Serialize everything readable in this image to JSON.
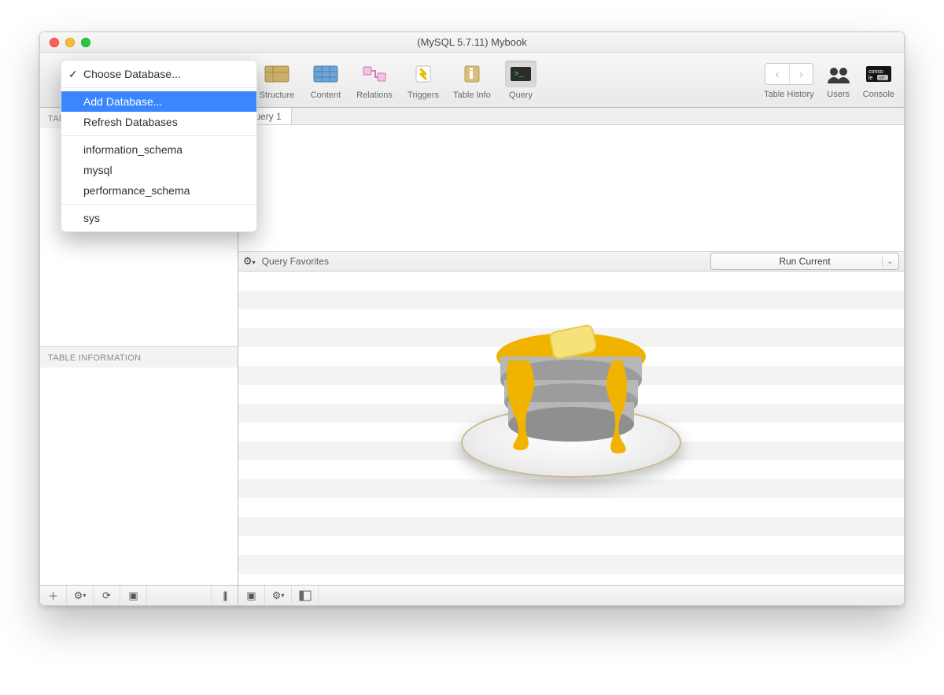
{
  "window": {
    "title": "(MySQL 5.7.11) Mybook"
  },
  "toolbar": {
    "db_selector_label": "Choose Database...",
    "items": [
      {
        "label": "Structure"
      },
      {
        "label": "Content"
      },
      {
        "label": "Relations"
      },
      {
        "label": "Triggers"
      },
      {
        "label": "Table Info"
      },
      {
        "label": "Query"
      }
    ],
    "right": {
      "history": "Table History",
      "users": "Users",
      "console": "Console"
    }
  },
  "sidebar": {
    "tables_header": "TABLES",
    "info_header": "TABLE INFORMATION"
  },
  "tabs": {
    "first": "Query 1"
  },
  "favbar": {
    "label": "Query Favorites",
    "run": "Run Current"
  },
  "menu": {
    "choose": "Choose Database...",
    "add": "Add Database...",
    "refresh": "Refresh Databases",
    "dbs": [
      "information_schema",
      "mysql",
      "performance_schema"
    ],
    "dbs2": [
      "sys"
    ]
  },
  "icons": {
    "structure": "structure-icon",
    "content": "content-icon",
    "relations": "relations-icon",
    "triggers": "triggers-icon",
    "tableinfo": "tableinfo-icon",
    "query": "query-icon",
    "users": "users-icon",
    "console": "console-icon"
  }
}
